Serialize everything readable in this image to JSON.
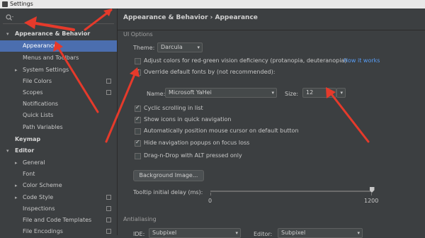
{
  "window": {
    "title": "Settings"
  },
  "sidebar": {
    "search_placeholder": "",
    "items": [
      {
        "label": "Appearance & Behavior",
        "arrow": "▾"
      },
      {
        "label": "Appearance"
      },
      {
        "label": "Menus and Toolbars"
      },
      {
        "label": "System Settings",
        "arrow": "▸"
      },
      {
        "label": "File Colors"
      },
      {
        "label": "Scopes"
      },
      {
        "label": "Notifications"
      },
      {
        "label": "Quick Lists"
      },
      {
        "label": "Path Variables"
      },
      {
        "label": "Keymap"
      },
      {
        "label": "Editor",
        "arrow": "▾"
      },
      {
        "label": "General",
        "arrow": "▸"
      },
      {
        "label": "Font"
      },
      {
        "label": "Color Scheme",
        "arrow": "▸"
      },
      {
        "label": "Code Style",
        "arrow": "▸"
      },
      {
        "label": "Inspections"
      },
      {
        "label": "File and Code Templates"
      },
      {
        "label": "File Encodings"
      }
    ]
  },
  "main": {
    "breadcrumb": "Appearance & Behavior  ›  Appearance",
    "ui_options_title": "UI Options",
    "theme_label": "Theme:",
    "theme_value": "Darcula",
    "adjust_colors_label": "Adjust colors for red-green vision deficiency (protanopia, deuteranopia)",
    "how_it_works": "How it works",
    "override_fonts_label": "Override default fonts by (not recommended):",
    "name_label": "Name:",
    "name_value": "Microsoft YaHei",
    "size_label": "Size:",
    "size_value": "12",
    "cyclic_label": "Cyclic scrolling in list",
    "show_icons_label": "Show icons in quick navigation",
    "auto_position_label": "Automatically position mouse cursor on default button",
    "hide_popups_label": "Hide navigation popups on focus loss",
    "drag_drop_label": "Drag-n-Drop with ALT pressed only",
    "background_image_button": "Background Image...",
    "tooltip_delay_label": "Tooltip initial delay (ms):",
    "slider_min": "0",
    "slider_max": "1200",
    "slider_value": 1200,
    "antialiasing_title": "Antialiasing",
    "ide_label": "IDE:",
    "ide_value": "Subpixel",
    "editor_label": "Editor:",
    "editor_value": "Subpixel"
  },
  "checkboxes": {
    "adjust_colors": false,
    "override_fonts": true,
    "cyclic": true,
    "show_icons": true,
    "auto_position": false,
    "hide_popups": true,
    "drag_drop": false
  },
  "colors": {
    "background": "#3c3f41",
    "selection": "#4b6eaf",
    "link": "#589df6",
    "annotation_arrow": "#e53a2b"
  }
}
